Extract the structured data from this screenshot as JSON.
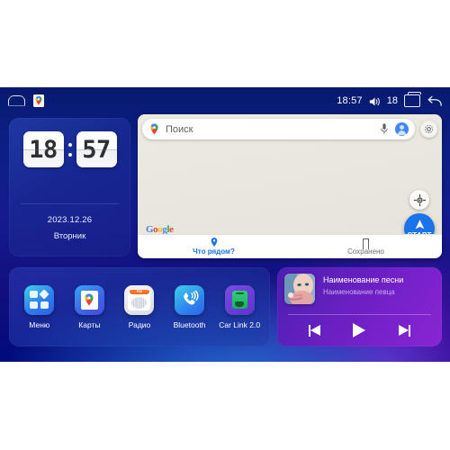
{
  "statusbar": {
    "home_icon": "home-icon",
    "notification_icon": "google-maps-notification-icon",
    "time": "18:57",
    "volume_icon": "volume-icon",
    "volume_level": "18",
    "recents_icon": "recents-icon",
    "back_icon": "back-icon"
  },
  "clock_widget": {
    "hours": "18",
    "minutes": "57",
    "date": "2023.12.26",
    "weekday": "Вторник"
  },
  "maps_widget": {
    "search": {
      "placeholder": "Поиск",
      "pin_icon": "google-maps-pin-icon",
      "mic_icon": "microphone-icon",
      "avatar_icon": "account-avatar-icon",
      "layers_icon": "map-layers-icon"
    },
    "google_logo": {
      "g": "G",
      "o1": "o",
      "o2": "o",
      "g2": "g",
      "l": "l",
      "e": "e"
    },
    "locate_icon": "my-location-icon",
    "start_button": {
      "label": "СТАРТ",
      "icon": "navigation-arrow-icon"
    },
    "bottom_nav": [
      {
        "label": "Что рядом?",
        "icon": "location-pin-icon",
        "active": true
      },
      {
        "label": "Сохранено",
        "icon": "bookmark-icon",
        "active": false
      }
    ]
  },
  "app_dock": {
    "apps": [
      {
        "label": "Меню",
        "icon": "apps-grid-icon"
      },
      {
        "label": "Карты",
        "icon": "google-maps-icon"
      },
      {
        "label": "Радио",
        "icon": "fm-radio-icon",
        "badge": "FM"
      },
      {
        "label": "Bluetooth",
        "icon": "bluetooth-phone-icon"
      },
      {
        "label": "Car Link 2.0",
        "icon": "car-link-icon"
      }
    ]
  },
  "music_widget": {
    "album_art_icon": "album-art-portrait",
    "title": "Наименование песни",
    "artist": "Наименование певца",
    "controls": {
      "previous": "previous-track-icon",
      "play": "play-icon",
      "next": "next-track-icon"
    }
  },
  "colors": {
    "accent_blue": "#1a73e8",
    "background_blue": "#0d1f86",
    "music_purple": "#7a22cc",
    "radio_orange": "#ef6a22"
  }
}
